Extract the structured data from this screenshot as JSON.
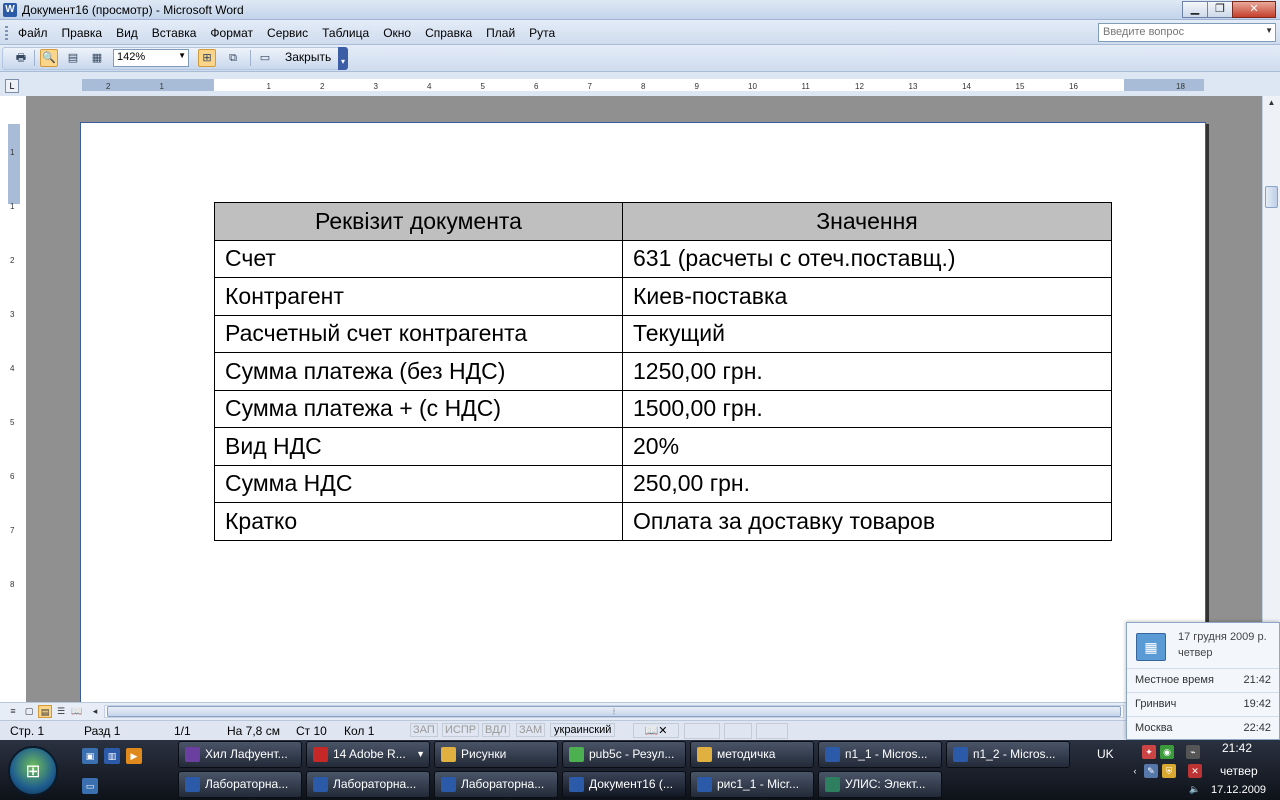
{
  "window": {
    "title": "Документ16 (просмотр) - Microsoft Word",
    "app_icon": "word-icon"
  },
  "menu": {
    "items": [
      "Файл",
      "Правка",
      "Вид",
      "Вставка",
      "Формат",
      "Сервис",
      "Таблица",
      "Окно",
      "Справка",
      "Плай",
      "Рута"
    ],
    "ask_placeholder": "Введите вопрос"
  },
  "toolbar": {
    "zoom": "142%",
    "close_label": "Закрыть"
  },
  "ruler": {
    "h_ticks": [
      "2",
      "1",
      "",
      "1",
      "2",
      "3",
      "4",
      "5",
      "6",
      "7",
      "8",
      "9",
      "10",
      "11",
      "12",
      "13",
      "14",
      "15",
      "16",
      "",
      "18"
    ],
    "v_ticks": [
      "1",
      "1",
      "2",
      "3",
      "4",
      "5",
      "6",
      "7",
      "8"
    ]
  },
  "table": {
    "headers": [
      "Реквізит документа",
      "Значення"
    ],
    "rows": [
      [
        "Счет",
        "631 (расчеты с отеч.поставщ.)"
      ],
      [
        "Контрагент",
        "Киев-поставка"
      ],
      [
        "Расчетный счет контрагента",
        "Текущий"
      ],
      [
        "Сумма платежа (без НДС)",
        "1250,00 грн."
      ],
      [
        "Сумма платежа + (с НДС)",
        "1500,00 грн."
      ],
      [
        "Вид НДС",
        "20%"
      ],
      [
        "Сумма НДС",
        "250,00 грн."
      ],
      [
        "Кратко",
        "Оплата за доставку товаров"
      ]
    ]
  },
  "status": {
    "page": "Стр. 1",
    "section": "Разд 1",
    "pages": "1/1",
    "at": "На 7,8 см",
    "line": "Ст 10",
    "col": "Кол 1",
    "rec": "ЗАП",
    "trk": "ИСПР",
    "ext": "ВДЛ",
    "ovr": "ЗАМ",
    "language": "украинский"
  },
  "clock_popup": {
    "date": "17 грудня 2009 р.",
    "day": "четвер",
    "rows": [
      {
        "label": "Местное время",
        "time": "21:42"
      },
      {
        "label": "Гринвич",
        "time": "19:42"
      },
      {
        "label": "Москва",
        "time": "22:42"
      }
    ]
  },
  "taskbar": {
    "row1": [
      {
        "label": "Хил Лафуент...",
        "icon": "media-player-icon",
        "color": "#6b3fa0"
      },
      {
        "label": "14 Adobe R...",
        "icon": "pdf-icon",
        "color": "#c62828"
      },
      {
        "label": "Рисунки",
        "icon": "folder-icon",
        "color": "#e0b040"
      },
      {
        "label": "pub5c - Резул...",
        "icon": "page-icon",
        "color": "#4caf50"
      },
      {
        "label": "методичка",
        "icon": "folder-icon",
        "color": "#e0b040"
      },
      {
        "label": "п1_1 - Micros...",
        "icon": "word-icon",
        "color": "#2b5aa8"
      },
      {
        "label": "п1_2 - Micros...",
        "icon": "word-icon",
        "color": "#2b5aa8"
      }
    ],
    "row2": [
      {
        "label": "Лабораторна...",
        "icon": "word-icon",
        "color": "#2b5aa8"
      },
      {
        "label": "Лабораторна...",
        "icon": "word-icon",
        "color": "#2b5aa8"
      },
      {
        "label": "Лабораторна...",
        "icon": "word-icon",
        "color": "#2b5aa8"
      },
      {
        "label": "Документ16 (...",
        "icon": "word-icon",
        "color": "#2b5aa8"
      },
      {
        "label": "рис1_1 - Micr...",
        "icon": "word-icon",
        "color": "#2b5aa8"
      },
      {
        "label": "УЛИС: Элект...",
        "icon": "app-icon",
        "color": "#2d7f5f"
      }
    ],
    "lang": "UK",
    "time": "21:42",
    "day": "четвер",
    "date": "17.12.2009"
  }
}
